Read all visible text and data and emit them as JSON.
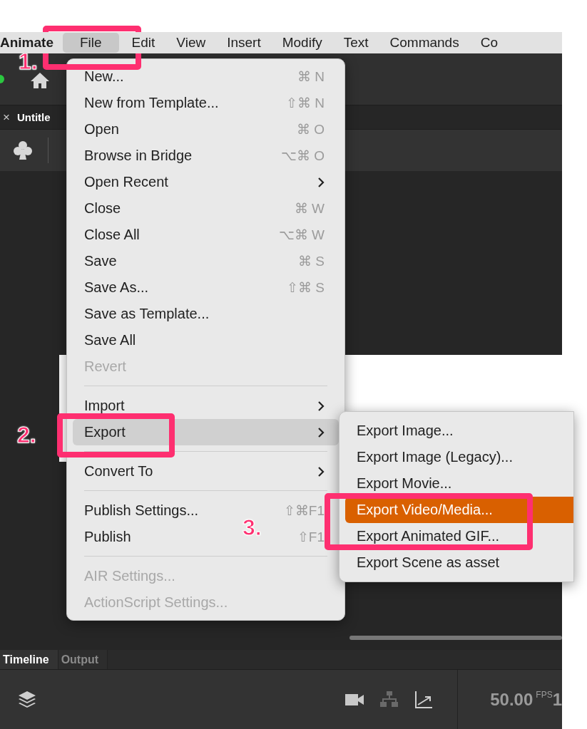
{
  "menubar": {
    "items": [
      {
        "label": "Animate",
        "kind": "app",
        "selected": false
      },
      {
        "label": "File",
        "kind": "menu",
        "selected": true
      },
      {
        "label": "Edit",
        "kind": "menu",
        "selected": false
      },
      {
        "label": "View",
        "kind": "menu",
        "selected": false
      },
      {
        "label": "Insert",
        "kind": "menu",
        "selected": false
      },
      {
        "label": "Modify",
        "kind": "menu",
        "selected": false
      },
      {
        "label": "Text",
        "kind": "menu",
        "selected": false
      },
      {
        "label": "Commands",
        "kind": "menu",
        "selected": false
      },
      {
        "label": "Co",
        "kind": "menu",
        "selected": false
      }
    ]
  },
  "document_tab": {
    "close": "×",
    "label": "Untitle"
  },
  "file_menu": {
    "items": [
      {
        "kind": "item",
        "label": "New...",
        "shortcut": "⌘ N",
        "disabled": false,
        "selected": false
      },
      {
        "kind": "item",
        "label": "New from Template...",
        "shortcut": "⇧⌘ N",
        "disabled": false,
        "selected": false
      },
      {
        "kind": "item",
        "label": "Open",
        "shortcut": "⌘ O",
        "disabled": false,
        "selected": false
      },
      {
        "kind": "item",
        "label": "Browse in Bridge",
        "shortcut": "⌥⌘ O",
        "disabled": false,
        "selected": false
      },
      {
        "kind": "submenu",
        "label": "Open Recent",
        "disabled": false,
        "selected": false
      },
      {
        "kind": "item",
        "label": "Close",
        "shortcut": "⌘ W",
        "disabled": false,
        "selected": false
      },
      {
        "kind": "item",
        "label": "Close All",
        "shortcut": "⌥⌘ W",
        "disabled": false,
        "selected": false
      },
      {
        "kind": "item",
        "label": "Save",
        "shortcut": "⌘ S",
        "disabled": false,
        "selected": false
      },
      {
        "kind": "item",
        "label": "Save As...",
        "shortcut": "⇧⌘ S",
        "disabled": false,
        "selected": false
      },
      {
        "kind": "item",
        "label": "Save as Template...",
        "disabled": false,
        "selected": false
      },
      {
        "kind": "item",
        "label": "Save All",
        "disabled": false,
        "selected": false
      },
      {
        "kind": "item",
        "label": "Revert",
        "disabled": true,
        "selected": false
      },
      {
        "kind": "separator"
      },
      {
        "kind": "submenu",
        "label": "Import",
        "disabled": false,
        "selected": false
      },
      {
        "kind": "submenu",
        "label": "Export",
        "disabled": false,
        "selected": true
      },
      {
        "kind": "separator"
      },
      {
        "kind": "submenu",
        "label": "Convert To",
        "disabled": false,
        "selected": false
      },
      {
        "kind": "separator"
      },
      {
        "kind": "item",
        "label": "Publish Settings...",
        "shortcut": "⇧⌘F1",
        "disabled": false,
        "selected": false
      },
      {
        "kind": "item",
        "label": "Publish",
        "shortcut": "⇧F1",
        "disabled": false,
        "selected": false
      },
      {
        "kind": "separator"
      },
      {
        "kind": "item",
        "label": "AIR Settings...",
        "disabled": true,
        "selected": false
      },
      {
        "kind": "item",
        "label": "ActionScript Settings...",
        "disabled": true,
        "selected": false
      }
    ]
  },
  "export_submenu": {
    "items": [
      {
        "label": "Export Image...",
        "selected": false
      },
      {
        "label": "Export Image (Legacy)...",
        "selected": false
      },
      {
        "label": "Export Movie...",
        "selected": false
      },
      {
        "label": "Export Video/Media...",
        "selected": true
      },
      {
        "label": "Export Animated GIF...",
        "selected": false
      },
      {
        "label": "Export Scene as asset",
        "selected": false
      }
    ]
  },
  "timeline": {
    "tabs": [
      {
        "label": "Timeline",
        "selected": true
      },
      {
        "label": "Output",
        "selected": false
      }
    ],
    "fps": "50.00",
    "fps_unit": "FPS",
    "frame": "1"
  },
  "annotations": [
    {
      "label": "1."
    },
    {
      "label": "2."
    },
    {
      "label": "3."
    }
  ]
}
